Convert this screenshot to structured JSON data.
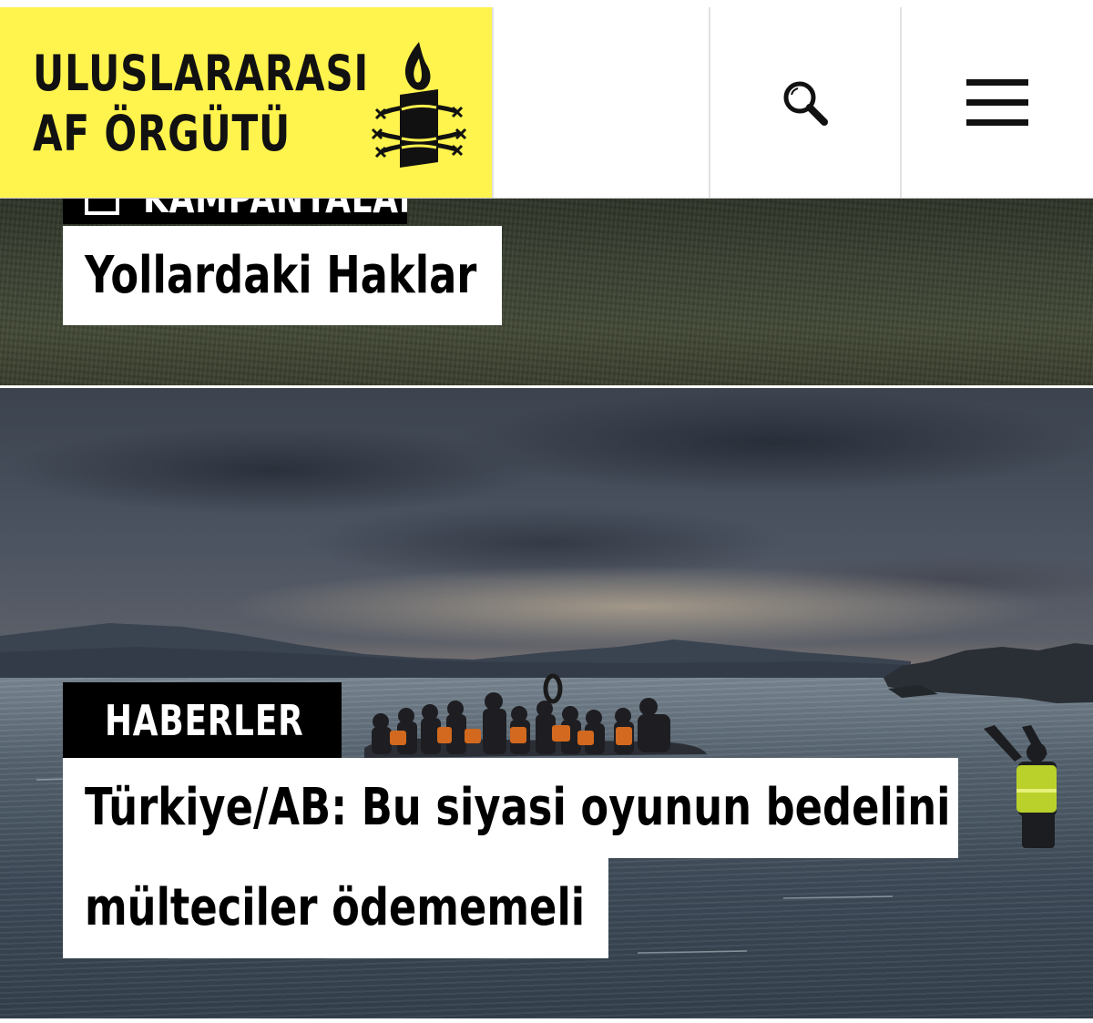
{
  "header": {
    "logo_line1": "ULUSLARARASI",
    "logo_line2": "AF ÖRGÜTÜ",
    "logo_icon": "candle-barbed-wire-icon",
    "search_icon": "search-icon",
    "menu_icon": "hamburger-menu-icon",
    "brand_color": "#fff34d"
  },
  "cards": [
    {
      "category": "KAMPANYALAR",
      "category_icon": "campaign-icon",
      "title": "Yollardaki Haklar"
    },
    {
      "category": "HABERLER",
      "category_icon": "news-icon",
      "title_line1": "Türkiye/AB: Bu siyasi oyunun bedelini",
      "title_line2": "mülteciler ödememeli"
    }
  ]
}
